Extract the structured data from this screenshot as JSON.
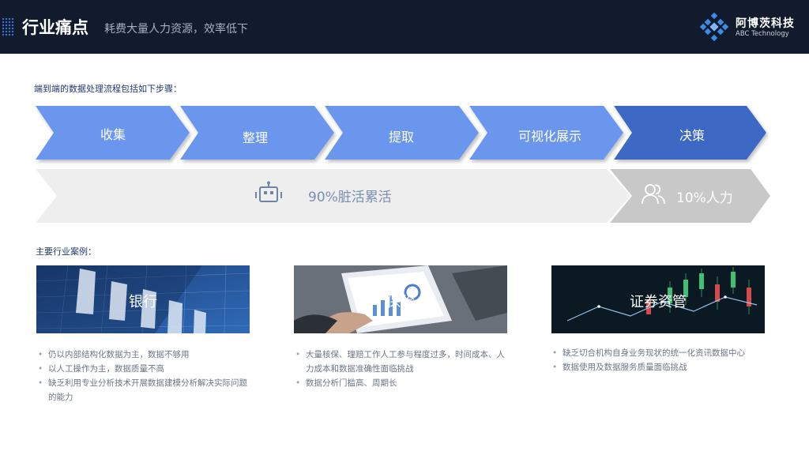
{
  "header": {
    "title": "行业痛点",
    "subtitle": "耗费大量人力资源，效率低下",
    "brand_cn": "阿博茨科技",
    "brand_en": "ABC Technology",
    "logo_icon": "diamond-logo-icon",
    "colors": {
      "background": "#111b2b",
      "accent": "#3b6fd6"
    }
  },
  "intro": "端到端的数据处理流程包括如下步骤：",
  "steps": [
    {
      "label": "收集",
      "color": "#6b96ee"
    },
    {
      "label": "整理",
      "color": "#6b96ee"
    },
    {
      "label": "提取",
      "color": "#6b96ee"
    },
    {
      "label": "可视化展示",
      "color": "#6b96ee"
    },
    {
      "label": "决策",
      "color": "#3e67c4"
    }
  ],
  "bar": {
    "main_label": "90%脏活累活",
    "side_label": "10%人力",
    "main_icon": "robot-icon",
    "side_icon": "people-icon",
    "main_color": "#eeeeee",
    "side_color": "#c8c8c8"
  },
  "section_title": "主要行业案例：",
  "cases": [
    {
      "label": "银行",
      "image": "bank-building-image",
      "bullets": [
        "仍以内部结构化数据为主，数据不够用",
        "以人工操作为主，数据质量不高",
        "缺乏利用专业分析技术开展数据建模分析解决实际问题的能力"
      ]
    },
    {
      "label": "保险",
      "image": "tablet-chart-image",
      "bullets": [
        "大量核保、理赔工作人工参与程度过多，时间成本、人力成本和数据准确性面临挑战",
        "数据分析门槛高、周期长"
      ]
    },
    {
      "label": "证券资管",
      "image": "stock-candlestick-image",
      "bullets": [
        "缺乏切合机构自身业务现状的统一化资讯数据中心",
        "数据使用及数据服务质量面临挑战"
      ]
    }
  ]
}
